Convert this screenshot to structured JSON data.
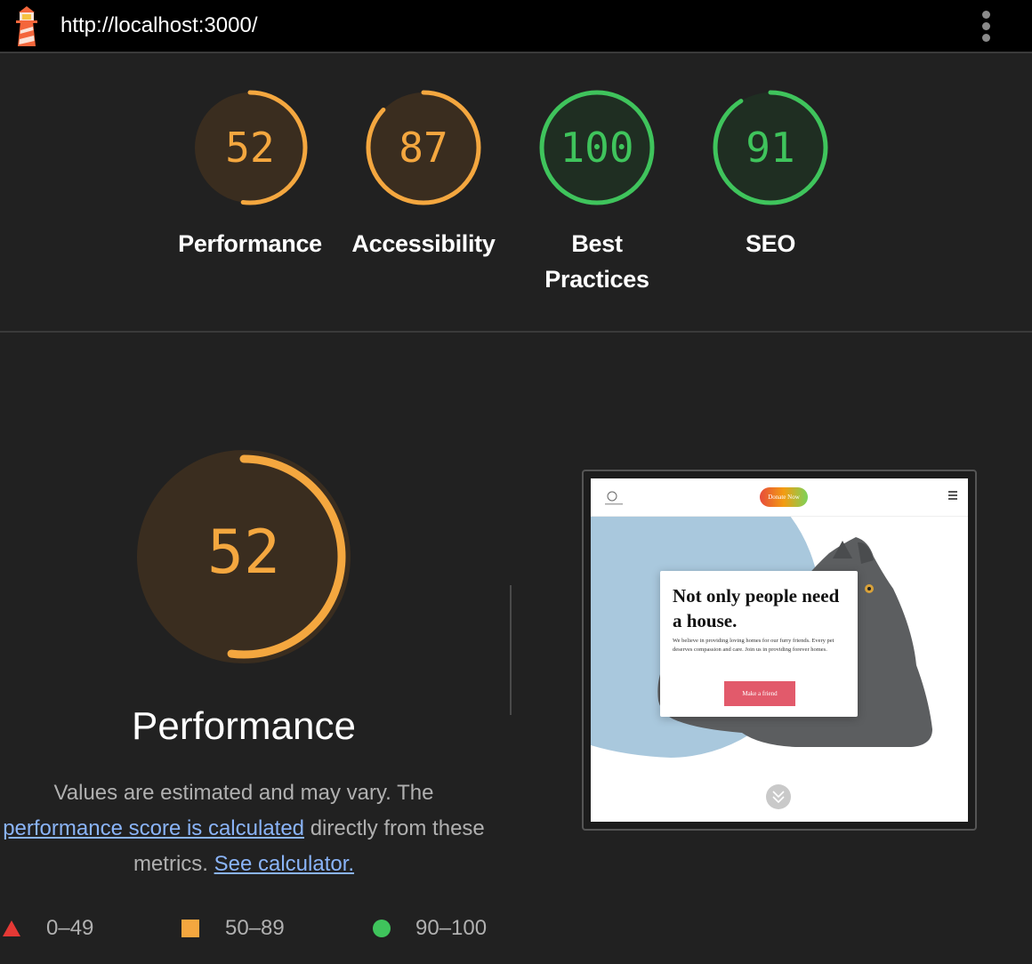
{
  "topbar": {
    "url": "http://localhost:3000/",
    "logo_icon": "lighthouse-icon",
    "menu_icon": "kebab-menu-icon"
  },
  "colors": {
    "average": "#f4a73f",
    "pass": "#3fc45c",
    "fail": "#e53935",
    "average_bg": "#3a2d1f",
    "pass_bg": "#1f2e22"
  },
  "scores": [
    {
      "value": 52,
      "label": "Performance",
      "status": "average"
    },
    {
      "value": 87,
      "label": "Accessibility",
      "status": "average"
    },
    {
      "value": 100,
      "label": "Best Practices",
      "status": "pass"
    },
    {
      "value": 91,
      "label": "SEO",
      "status": "pass"
    }
  ],
  "performance": {
    "score": 52,
    "title": "Performance",
    "desc_part1": "Values are estimated and may vary. The",
    "desc_link1": "performance score is calculated",
    "desc_part2": "directly from these metrics.",
    "desc_link2": "See calculator."
  },
  "screenshot": {
    "donate_label": "Donate Now",
    "heading": "Not only people need a house.",
    "body": "We believe in providing loving homes for our furry friends. Every pet deserves compassion and care. Join us in providing forever homes.",
    "button_label": "Make a friend",
    "scroll_icon": "chevron-double-down-icon"
  },
  "legend": [
    {
      "range": "0–49",
      "icon": "triangle-icon",
      "color": "#e53935"
    },
    {
      "range": "50–89",
      "icon": "square-icon",
      "color": "#f4a73f"
    },
    {
      "range": "90–100",
      "icon": "circle-icon",
      "color": "#3fc45c"
    }
  ]
}
